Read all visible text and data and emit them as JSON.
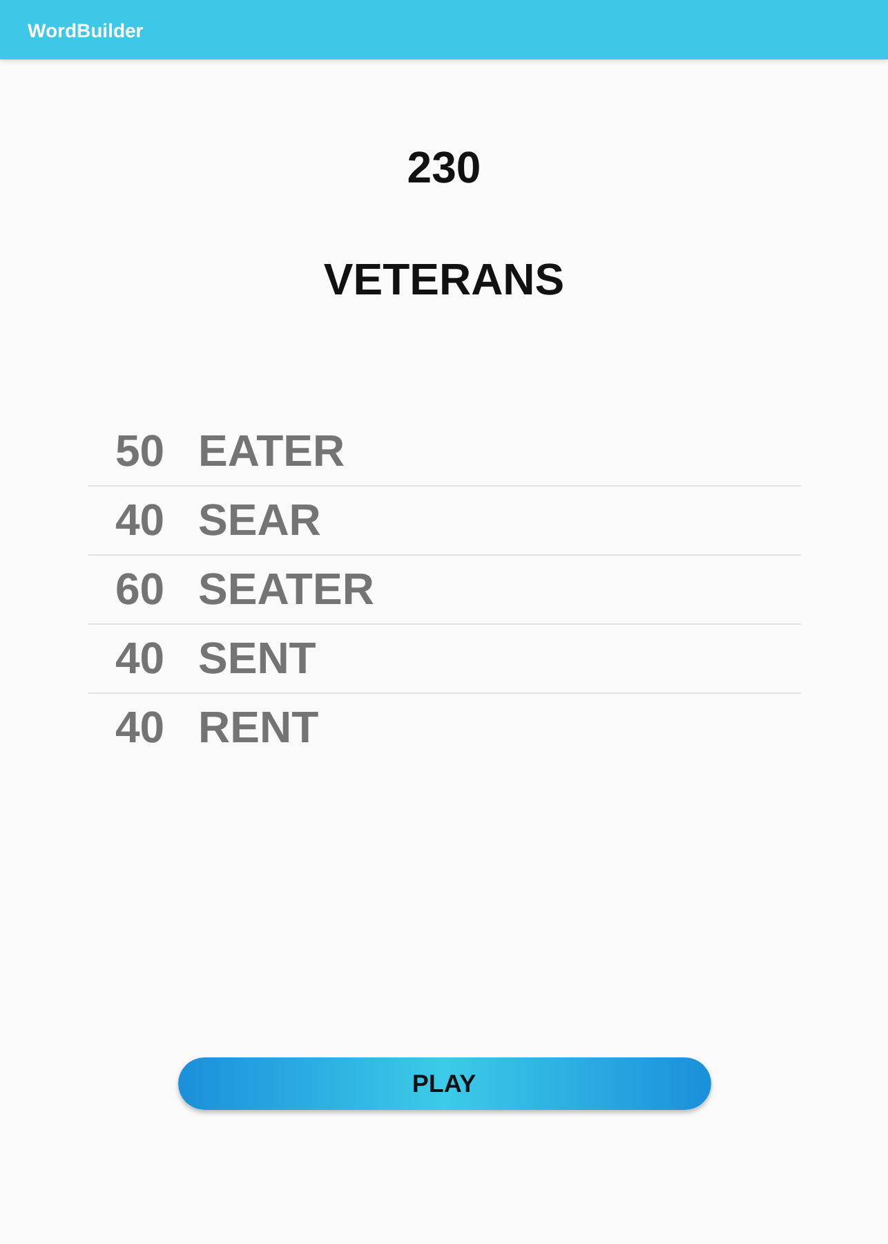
{
  "app_bar": {
    "title": "WordBuilder"
  },
  "score": "230",
  "word": "VETERANS",
  "found_words": [
    {
      "points": "50",
      "word": "EATER"
    },
    {
      "points": "40",
      "word": "SEAR"
    },
    {
      "points": "60",
      "word": "SEATER"
    },
    {
      "points": "40",
      "word": "SENT"
    },
    {
      "points": "40",
      "word": "RENT"
    }
  ],
  "play_button": "PLAY"
}
